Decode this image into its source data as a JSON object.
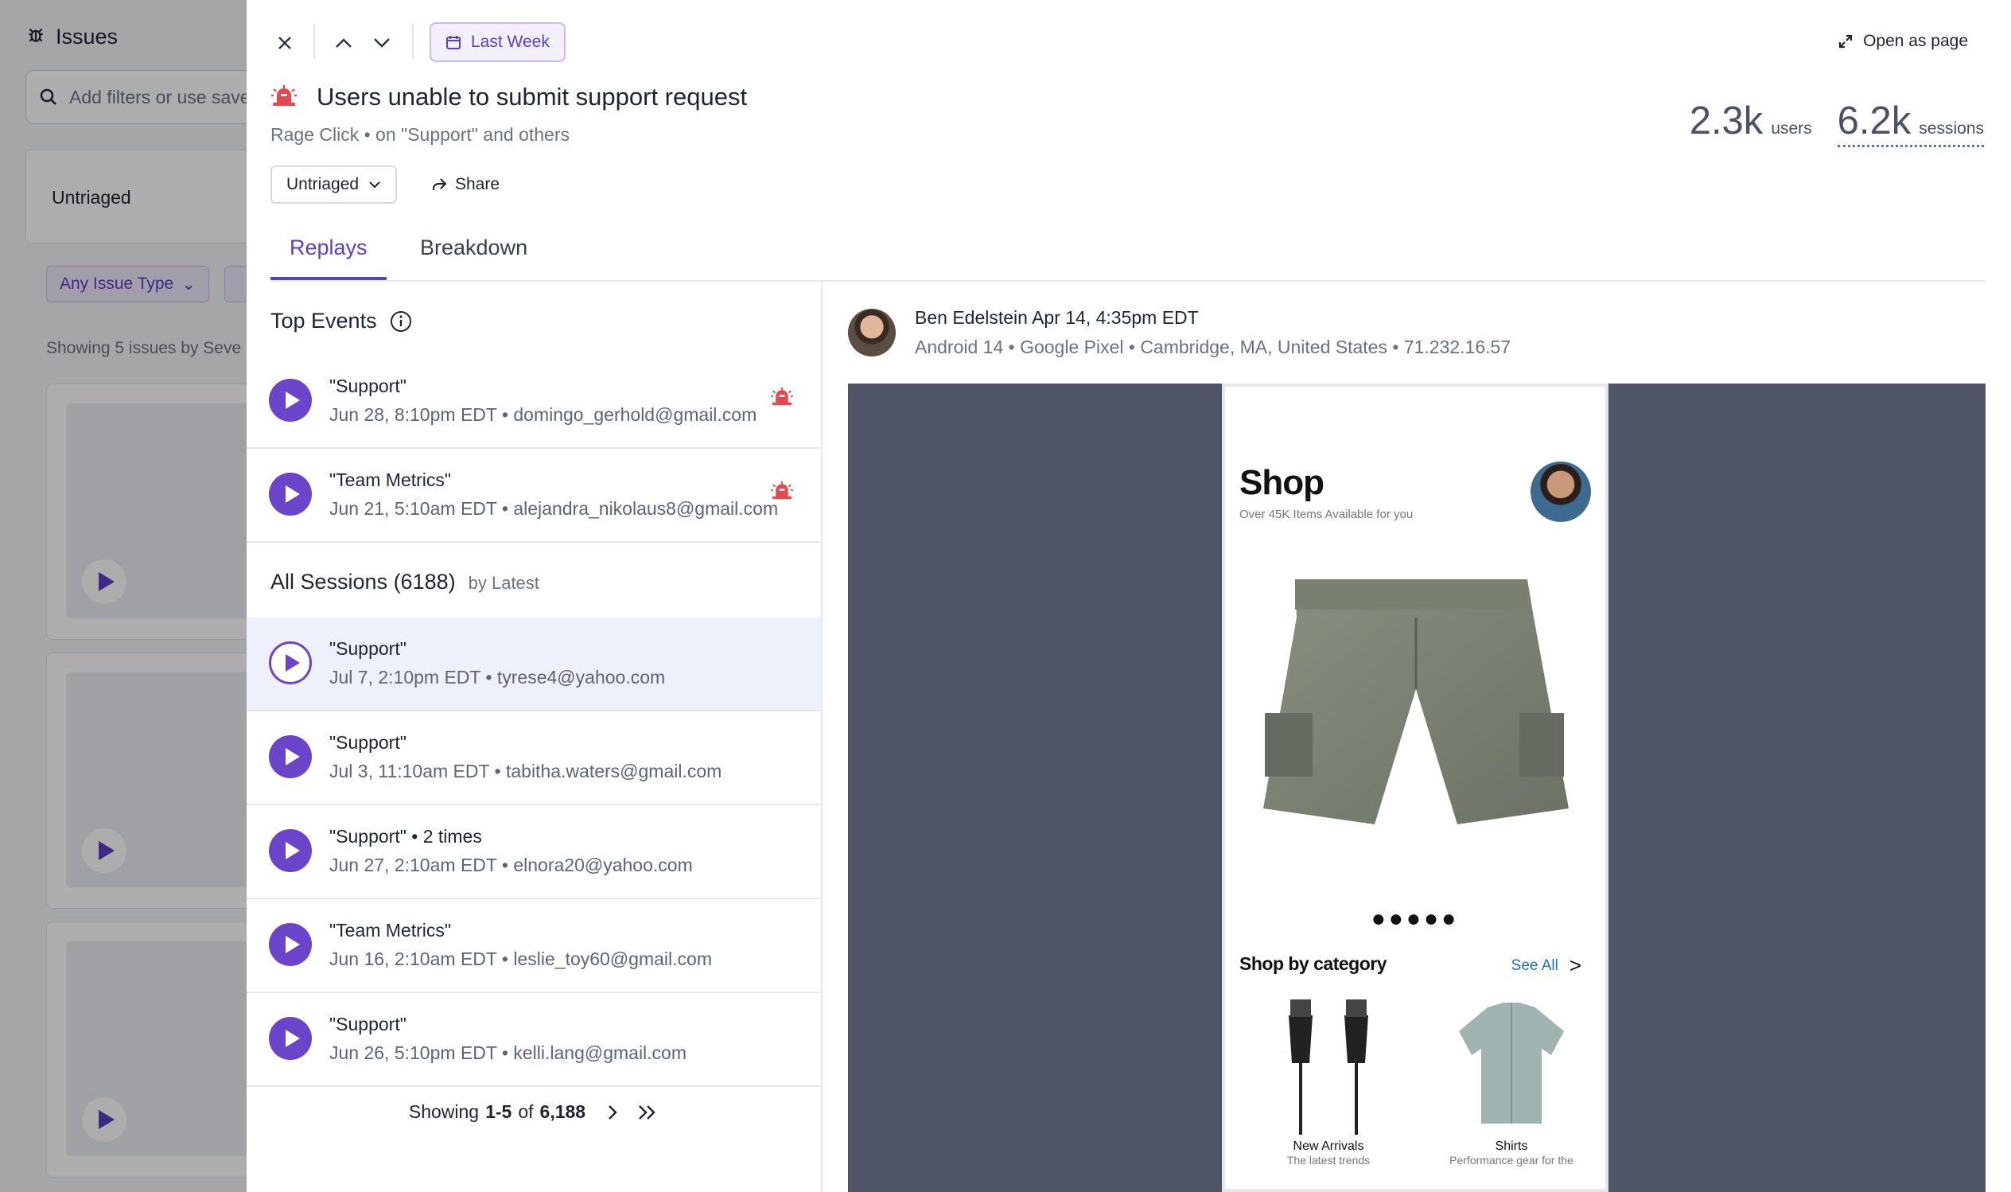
{
  "background": {
    "title": "Issues",
    "search_placeholder": "Add filters or use saved",
    "tab_label": "Untriaged",
    "filter_label": "Any Issue Type",
    "showing_text": "Showing 5 issues by Seve"
  },
  "toolbar": {
    "date_range": "Last Week",
    "open_as_page": "Open as page"
  },
  "issue": {
    "title": "Users unable to submit support request",
    "type": "Rage Click",
    "context": " • on \"Support\" and others",
    "status": "Untriaged",
    "share_label": "Share"
  },
  "metrics": {
    "users_value": "2.3k",
    "users_label": "users",
    "sessions_value": "6.2k",
    "sessions_label": "sessions"
  },
  "tabs": [
    {
      "label": "Replays"
    },
    {
      "label": "Breakdown"
    }
  ],
  "top_events": {
    "heading": "Top Events",
    "items": [
      {
        "title": "\"Support\"",
        "meta": "Jun 28, 8:10pm EDT • domingo_gerhold@gmail.com"
      },
      {
        "title": "\"Team Metrics\"",
        "meta": "Jun 21, 5:10am EDT • alejandra_nikolaus8@gmail.com"
      }
    ]
  },
  "sessions": {
    "heading": "All Sessions (6188)",
    "sort": "by Latest",
    "items": [
      {
        "title": "\"Support\"",
        "meta": "Jul 7, 2:10pm EDT • tyrese4@yahoo.com"
      },
      {
        "title": "\"Support\"",
        "meta": "Jul 3, 11:10am EDT • tabitha.waters@gmail.com"
      },
      {
        "title": "\"Support\" • 2 times",
        "meta": "Jun 27, 2:10am EDT • elnora20@yahoo.com"
      },
      {
        "title": "\"Team Metrics\"",
        "meta": "Jun 16, 2:10am EDT • leslie_toy60@gmail.com"
      },
      {
        "title": "\"Support\"",
        "meta": "Jun 26, 5:10pm EDT • kelli.lang@gmail.com"
      }
    ]
  },
  "pager": {
    "prefix": "Showing",
    "range": "1-5",
    "of": "of",
    "total": "6,188"
  },
  "replay": {
    "user_name": "Ben Edelstein",
    "timestamp": "Apr 14, 4:35pm EDT",
    "device_info": "Android 14 • Google Pixel • Cambridge, MA, United States • 71.232.16.57"
  },
  "phone_app": {
    "title": "Shop",
    "subtitle": "Over 45K Items Available for you",
    "dots": "●●●●●",
    "category_heading": "Shop by category",
    "see_all": "See All",
    "items": [
      {
        "label": "New Arrivals",
        "sub": "The latest trends"
      },
      {
        "label": "Shirts",
        "sub": "Performance gear for the"
      }
    ]
  },
  "colors": {
    "accent": "#5b3fc4",
    "play": "#6a45c9",
    "rage": "#e5484d",
    "player_bg": "#4f5566"
  }
}
